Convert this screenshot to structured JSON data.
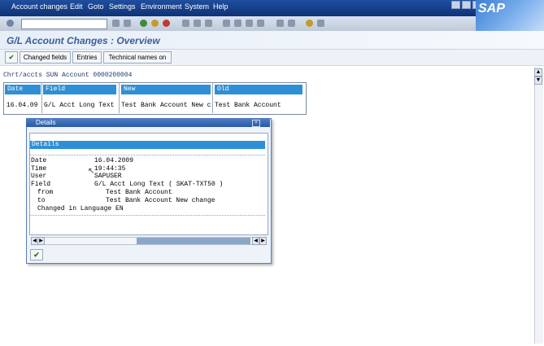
{
  "menu": [
    "Account changes",
    "Edit",
    "Goto",
    "Settings",
    "Environment",
    "System",
    "Help"
  ],
  "sap_logo": "SAP",
  "title": "G/L Account Changes : Overview",
  "app_toolbar": {
    "checkmark_icon": "check-icon",
    "buttons": [
      "Changed fields",
      "Entries",
      "Technical names on"
    ]
  },
  "header_line": "Chrt/accts SUN Account 0000200004",
  "table": {
    "columns": [
      "Date",
      "Field",
      "New",
      "Old"
    ],
    "rows": [
      [
        "16.04.09",
        "G/L Acct Long Text",
        "Test Bank Account New c",
        "Test Bank Account"
      ]
    ]
  },
  "dialog": {
    "title": "Details",
    "section_header": "Details",
    "date_label": "Date",
    "date_value": "16.04.2009",
    "time_label": "Time",
    "time_value": "19:44:35",
    "user_label": "User",
    "user_value": "SAPUSER",
    "field_label": "Field",
    "field_value": "G/L Acct Long Text ( SKAT-TXT50 )",
    "from_label": "from",
    "from_value": "Test Bank Account",
    "to_label": "to",
    "to_value": "Test Bank Account New change",
    "language_line": "Changed in Language EN"
  },
  "colors": {
    "menu_bg": "#1f4f9e",
    "accent": "#2f8fd6",
    "title_text": "#3d5f96"
  }
}
